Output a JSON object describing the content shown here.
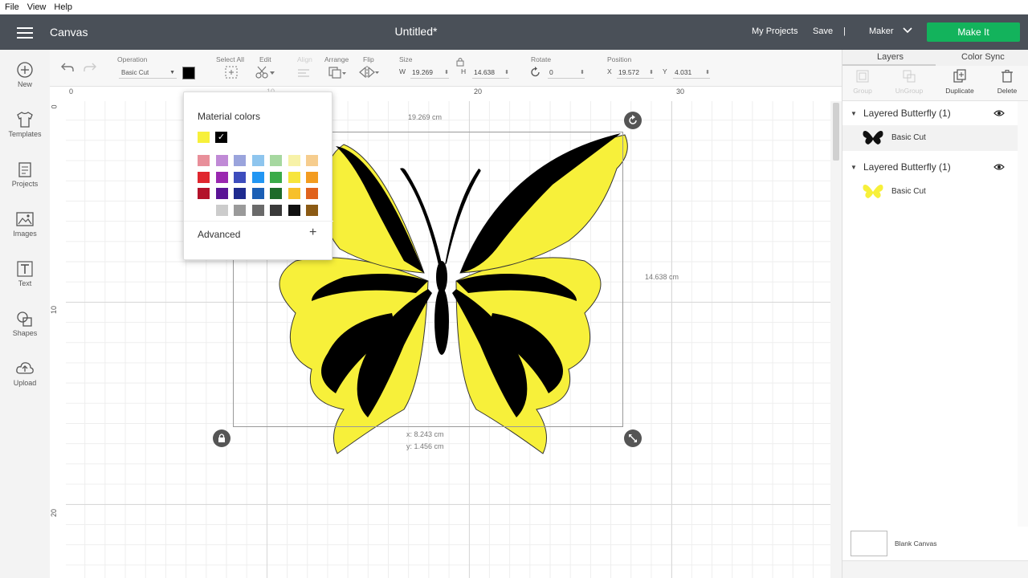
{
  "menubar": {
    "file": "File",
    "view": "View",
    "help": "Help"
  },
  "header": {
    "section": "Canvas",
    "title": "Untitled*",
    "my_projects": "My Projects",
    "save": "Save",
    "separator": "|",
    "machine": "Maker",
    "make_it": "Make It",
    "make_it_color": "#13b35c",
    "bg_color": "#4a5058"
  },
  "left_tools": [
    {
      "label": "New",
      "icon": "plus-circle-icon"
    },
    {
      "label": "Templates",
      "icon": "tshirt-icon"
    },
    {
      "label": "Projects",
      "icon": "projects-icon"
    },
    {
      "label": "Images",
      "icon": "images-icon"
    },
    {
      "label": "Text",
      "icon": "text-icon"
    },
    {
      "label": "Shapes",
      "icon": "shapes-icon"
    },
    {
      "label": "Upload",
      "icon": "upload-icon"
    }
  ],
  "toolbar": {
    "operation_label": "Operation",
    "operation_value": "Basic Cut",
    "select_all_label": "Select All",
    "edit_label": "Edit",
    "align_label": "Align",
    "arrange_label": "Arrange",
    "flip_label": "Flip",
    "size_label": "Size",
    "w_label": "W",
    "w_value": "19.269",
    "h_label": "H",
    "h_value": "14.638",
    "rotate_label": "Rotate",
    "rotate_value": "0",
    "position_label": "Position",
    "x_label": "X",
    "x_value": "19.572",
    "y_label": "Y",
    "y_value": "4.031",
    "color": "#000000"
  },
  "ruler": {
    "top": [
      "0",
      "10",
      "20",
      "30"
    ],
    "left": [
      "0",
      "10",
      "20"
    ]
  },
  "canvas": {
    "width_label": "19.269 cm",
    "height_label": "14.638 cm",
    "pos_x_label": "x: 8.243 cm",
    "pos_y_label": "y: 1.456 cm",
    "zoom": "100%"
  },
  "popup": {
    "title": "Material colors",
    "advanced": "Advanced",
    "plus": "+",
    "top_swatches": [
      "#f7f03a",
      "#000000"
    ],
    "swatches": [
      [
        "#e88f9a",
        "#c08ad6",
        "#9aa4dc",
        "#8ec5ee",
        "#a6d8a0",
        "#f7f2a8",
        "#f6cd8e"
      ],
      [
        "#e0262e",
        "#9a27b0",
        "#3d4dbd",
        "#2196f3",
        "#3aab49",
        "#f7e53c",
        "#f39c1f"
      ],
      [
        "#b3122a",
        "#5b1496",
        "#1e2b8f",
        "#1b5fb5",
        "#1e6b2a",
        "#f7c02a",
        "#e0621c"
      ],
      [
        "#ffffff",
        "#cccccc",
        "#9a9a9a",
        "#6a6a6a",
        "#3a3a3a",
        "#111111",
        "#8b5a14"
      ]
    ]
  },
  "right_panel": {
    "tabs": [
      "Layers",
      "Color Sync"
    ],
    "actions": [
      "Group",
      "UnGroup",
      "Duplicate",
      "Delete"
    ],
    "groups": [
      {
        "name": "Layered Butterfly (1)",
        "item": "Basic Cut",
        "thumb_color": "#000000"
      },
      {
        "name": "Layered Butterfly (1)",
        "item": "Basic Cut",
        "thumb_color": "#f7f03a"
      }
    ],
    "blank_canvas": "Blank Canvas"
  },
  "butterfly": {
    "upper_color": "#f7f03a",
    "outline_color": "#000000"
  }
}
